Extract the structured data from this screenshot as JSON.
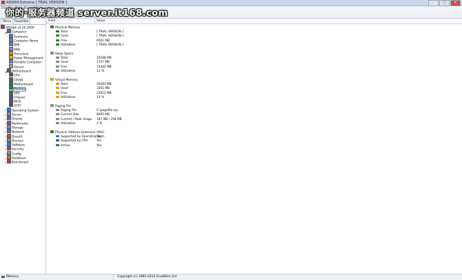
{
  "window": {
    "title": "AIDA64 Extreme  [ TRIAL VERSION ]",
    "watermark": "你的·服务器频道 server.it168.com"
  },
  "menu": {
    "items": [
      "File",
      "View",
      "Report",
      "Favorites",
      "Tools",
      "Help"
    ]
  },
  "toolbar": {
    "driver_updates_label": "Driver Updates"
  },
  "tabs": {
    "menu": "Menu",
    "favorites": "Favorites"
  },
  "tree": [
    {
      "label": "AIDA64 v5.20.3400",
      "level": 0,
      "icon": "aida-icon",
      "color": "#c0392b"
    },
    {
      "label": "Computer",
      "level": 1,
      "icon": "computer-icon",
      "color": "#3b6fb6",
      "exp": "◢"
    },
    {
      "label": "Summary",
      "level": 2,
      "icon": "summary-icon",
      "color": "#5a86c8"
    },
    {
      "label": "Computer Name",
      "level": 2,
      "icon": "computer-name-icon",
      "color": "#5a86c8"
    },
    {
      "label": "DMI",
      "level": 2,
      "icon": "dmi-icon",
      "color": "#5a86c8"
    },
    {
      "label": "IPMI",
      "level": 2,
      "icon": "ipmi-icon",
      "color": "#7d8ea5"
    },
    {
      "label": "Overclock",
      "level": 2,
      "icon": "overclock-icon",
      "color": "#e28a1f"
    },
    {
      "label": "Power Management",
      "level": 2,
      "icon": "power-icon",
      "color": "#e2b41f"
    },
    {
      "label": "Portable Computer",
      "level": 2,
      "icon": "portable-icon",
      "color": "#5a86c8"
    },
    {
      "label": "Sensor",
      "level": 2,
      "icon": "sensor-icon",
      "color": "#9c9c9c"
    },
    {
      "label": "Motherboard",
      "level": 1,
      "icon": "motherboard-icon",
      "color": "#2e7d32",
      "exp": "◢"
    },
    {
      "label": "CPU",
      "level": 2,
      "icon": "cpu-icon",
      "color": "#555"
    },
    {
      "label": "CPUID",
      "level": 2,
      "icon": "cpuid-icon",
      "color": "#555"
    },
    {
      "label": "Motherboard",
      "level": 2,
      "icon": "board-icon",
      "color": "#2e7d32"
    },
    {
      "label": "Memory",
      "level": 2,
      "icon": "memory-icon",
      "color": "#2e7d32",
      "selected": true
    },
    {
      "label": "SPD",
      "level": 2,
      "icon": "spd-icon",
      "color": "#2e7d32"
    },
    {
      "label": "Chipset",
      "level": 2,
      "icon": "chipset-icon",
      "color": "#555"
    },
    {
      "label": "BIOS",
      "level": 2,
      "icon": "bios-icon",
      "color": "#555"
    },
    {
      "label": "ACPI",
      "level": 2,
      "icon": "acpi-icon",
      "color": "#555"
    },
    {
      "label": "Operating System",
      "level": 1,
      "icon": "os-icon",
      "color": "#2f7fd8",
      "exp": "▷"
    },
    {
      "label": "Server",
      "level": 1,
      "icon": "server-icon",
      "color": "#7d8ea5",
      "exp": "▷"
    },
    {
      "label": "Display",
      "level": 1,
      "icon": "display-icon",
      "color": "#3b6fb6",
      "exp": "▷"
    },
    {
      "label": "Multimedia",
      "level": 1,
      "icon": "multimedia-icon",
      "color": "#8e44ad",
      "exp": "▷"
    },
    {
      "label": "Storage",
      "level": 1,
      "icon": "storage-icon",
      "color": "#7d8ea5",
      "exp": "▷"
    },
    {
      "label": "Network",
      "level": 1,
      "icon": "network-icon",
      "color": "#2f7fd8",
      "exp": "▷"
    },
    {
      "label": "DirectX",
      "level": 1,
      "icon": "directx-icon",
      "color": "#d35400",
      "exp": "▷"
    },
    {
      "label": "Devices",
      "level": 1,
      "icon": "devices-icon",
      "color": "#7d8ea5",
      "exp": "▷"
    },
    {
      "label": "Software",
      "level": 1,
      "icon": "software-icon",
      "color": "#2f7fd8",
      "exp": "▷"
    },
    {
      "label": "Security",
      "level": 1,
      "icon": "security-icon",
      "color": "#c0392b",
      "exp": "▷"
    },
    {
      "label": "Config",
      "level": 1,
      "icon": "config-icon",
      "color": "#7d8ea5",
      "exp": "▷"
    },
    {
      "label": "Database",
      "level": 1,
      "icon": "database-icon",
      "color": "#b8860b",
      "exp": "▷"
    },
    {
      "label": "Benchmark",
      "level": 1,
      "icon": "benchmark-icon",
      "color": "#c0392b",
      "exp": "▷"
    }
  ],
  "columns": {
    "field": "Field",
    "value": "Value"
  },
  "rows": [
    {
      "section": true,
      "field": "Physical Memory",
      "icon": "memory-module-icon",
      "color": "#2e7d32"
    },
    {
      "field": "Total",
      "value": "[ TRIAL VERSION ]",
      "icon": "memory-module-icon",
      "color": "#2e7d32"
    },
    {
      "field": "Used",
      "value": "[ TRIAL VERSION ]",
      "icon": "memory-module-icon",
      "color": "#2e7d32"
    },
    {
      "field": "Free",
      "value": "6561 MB",
      "icon": "memory-module-icon",
      "color": "#2e7d32"
    },
    {
      "field": "Utilization",
      "value": "[ TRIAL VERSION ]",
      "icon": "memory-module-icon",
      "color": "#2e7d32"
    },
    {
      "spacer": true
    },
    {
      "section": true,
      "field": "Swap Space",
      "icon": "swap-icon",
      "color": "#8a8a8a"
    },
    {
      "field": "Total",
      "value": "16188 MB",
      "icon": "swap-icon",
      "color": "#8a8a8a"
    },
    {
      "field": "Used",
      "value": "1747 MB",
      "icon": "swap-icon",
      "color": "#8a8a8a"
    },
    {
      "field": "Free",
      "value": "14442 MB",
      "icon": "swap-icon",
      "color": "#8a8a8a"
    },
    {
      "field": "Utilization",
      "value": "11 %",
      "icon": "swap-icon",
      "color": "#8a8a8a"
    },
    {
      "spacer": true
    },
    {
      "section": true,
      "field": "Virtual Memory",
      "icon": "virtual-memory-icon",
      "color": "#d4a017"
    },
    {
      "field": "Total",
      "value": "26283 MB",
      "icon": "virtual-memory-icon",
      "color": "#d4a017"
    },
    {
      "field": "Used",
      "value": "3261 MB",
      "icon": "virtual-memory-icon",
      "color": "#d4a017"
    },
    {
      "field": "Free",
      "value": "23023 MB",
      "icon": "virtual-memory-icon",
      "color": "#d4a017"
    },
    {
      "field": "Utilization",
      "value": "13 %",
      "icon": "virtual-memory-icon",
      "color": "#d4a017"
    },
    {
      "spacer": true
    },
    {
      "section": true,
      "field": "Paging File",
      "icon": "paging-file-icon",
      "color": "#8a8a8a"
    },
    {
      "field": "Paging File",
      "value": "C:\\pagefile.sys",
      "icon": "paging-file-icon",
      "color": "#8a8a8a"
    },
    {
      "field": "Current Size",
      "value": "8095 MB",
      "icon": "paging-file-icon",
      "color": "#8a8a8a"
    },
    {
      "field": "Current / Peak Usage",
      "value": "187 MB / 258 MB",
      "icon": "paging-file-icon",
      "color": "#8a8a8a"
    },
    {
      "field": "Utilization",
      "value": "2 %",
      "icon": "paging-file-icon",
      "color": "#8a8a8a"
    },
    {
      "spacer": true
    },
    {
      "section": true,
      "field": "Physical Address Extension (PAE)",
      "icon": "pae-icon",
      "color": "#2e7d32"
    },
    {
      "field": "Supported by Operating Syst...",
      "value": "Yes",
      "icon": "windows-icon",
      "color": "#2f7fd8"
    },
    {
      "field": "Supported by CPU",
      "value": "Yes",
      "icon": "cpu-icon",
      "color": "#555"
    },
    {
      "field": "Active",
      "value": "Yes",
      "icon": "memory-module-icon",
      "color": "#2e7d32"
    }
  ],
  "status": {
    "left": "Memory",
    "center": "Copyright (c) 1995-2015 FinalWire Ltd."
  }
}
